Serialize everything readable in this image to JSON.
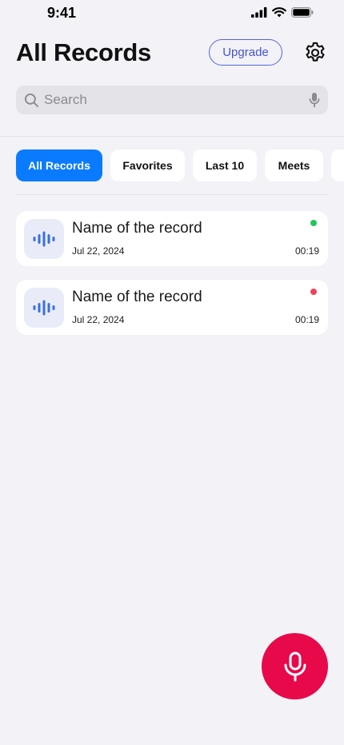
{
  "status_bar": {
    "time": "9:41"
  },
  "header": {
    "title": "All Records",
    "upgrade_label": "Upgrade"
  },
  "search": {
    "placeholder": "Search"
  },
  "filters": [
    {
      "label": "All Records",
      "active": true
    },
    {
      "label": "Favorites",
      "active": false
    },
    {
      "label": "Last 10",
      "active": false
    },
    {
      "label": "Meets",
      "active": false
    },
    {
      "label": "",
      "active": false
    }
  ],
  "records": [
    {
      "title": "Name of the record",
      "date": "Jul 22, 2024",
      "duration": "00:19",
      "status_color": "#22c55e"
    },
    {
      "title": "Name of the record",
      "date": "Jul 22, 2024",
      "duration": "00:19",
      "status_color": "#f0425a"
    }
  ],
  "icons": {
    "settings": "gear-icon",
    "search": "search-icon",
    "voice": "microphone-icon",
    "record_thumb": "waveform-icon",
    "record_button": "microphone-icon"
  },
  "colors": {
    "accent": "#0a7bff",
    "record_button": "#e8094a",
    "upgrade": "#4455cc",
    "waveform": "#3b6fe0"
  }
}
